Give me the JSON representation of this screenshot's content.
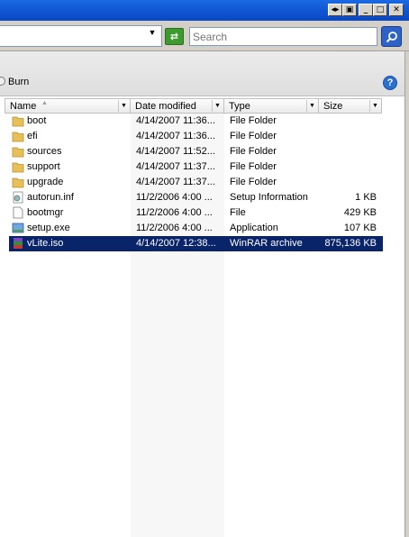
{
  "titlebar": {
    "buttons": [
      {
        "name": "unknown-dock-button",
        "glyph": "◂▸"
      },
      {
        "name": "unknown-restore-side-button",
        "glyph": "▣"
      },
      {
        "name": "minimize-button",
        "glyph": "_"
      },
      {
        "name": "maximize-button",
        "glyph": "□"
      },
      {
        "name": "close-button",
        "glyph": "✕"
      }
    ]
  },
  "search": {
    "placeholder": "Search"
  },
  "toolbar": {
    "burn_label": "Burn",
    "help_glyph": "?"
  },
  "columns": {
    "name": "Name",
    "date": "Date modified",
    "type": "Type",
    "size": "Size"
  },
  "files": [
    {
      "name": "boot",
      "date": "4/14/2007 11:36...",
      "type": "File Folder",
      "size": "",
      "icon": "folder-icon"
    },
    {
      "name": "efi",
      "date": "4/14/2007 11:36...",
      "type": "File Folder",
      "size": "",
      "icon": "folder-icon"
    },
    {
      "name": "sources",
      "date": "4/14/2007 11:52...",
      "type": "File Folder",
      "size": "",
      "icon": "folder-icon"
    },
    {
      "name": "support",
      "date": "4/14/2007 11:37...",
      "type": "File Folder",
      "size": "",
      "icon": "folder-icon"
    },
    {
      "name": "upgrade",
      "date": "4/14/2007 11:37...",
      "type": "File Folder",
      "size": "",
      "icon": "folder-icon"
    },
    {
      "name": "autorun.inf",
      "date": "11/2/2006 4:00 ...",
      "type": "Setup Information",
      "size": "1 KB",
      "icon": "setup-info-icon"
    },
    {
      "name": "bootmgr",
      "date": "11/2/2006 4:00 ...",
      "type": "File",
      "size": "429 KB",
      "icon": "file-icon"
    },
    {
      "name": "setup.exe",
      "date": "11/2/2006 4:00 ...",
      "type": "Application",
      "size": "107 KB",
      "icon": "application-icon"
    },
    {
      "name": "vLite.iso",
      "date": "4/14/2007 12:38...",
      "type": "WinRAR archive",
      "size": "875,136 KB",
      "icon": "winrar-archive-icon",
      "selected": true
    }
  ],
  "colors": {
    "selection": "#0a246a",
    "titlebar": "#0e53d1",
    "folder": "#e8c05a"
  }
}
